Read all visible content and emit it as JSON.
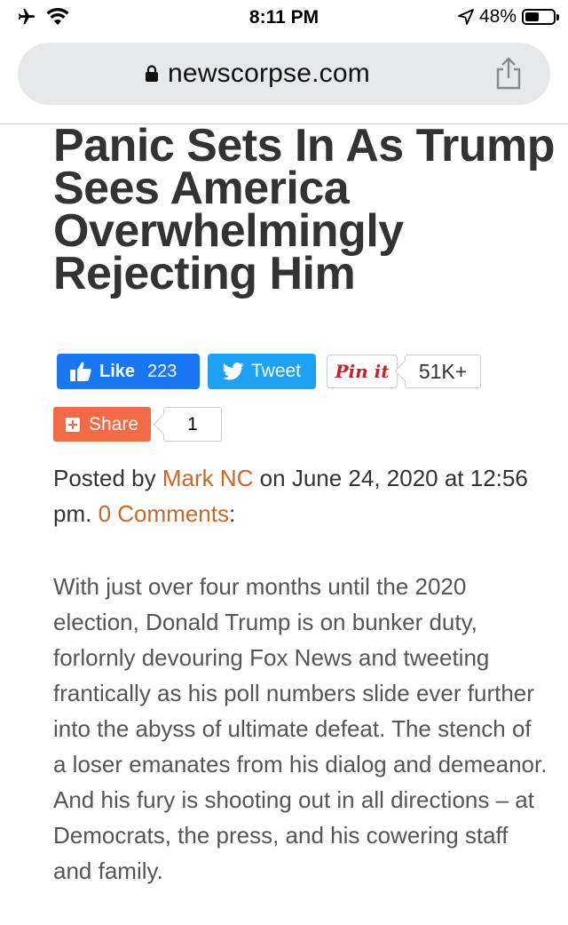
{
  "status_bar": {
    "time": "8:11 PM",
    "battery": "48%",
    "icons": [
      "airplane-icon",
      "wifi-icon",
      "location-arrow-icon",
      "battery-icon"
    ]
  },
  "browser": {
    "url": "newscorpse.com",
    "icons": [
      "lock-icon",
      "share-icon"
    ]
  },
  "article": {
    "title": "Panic Sets In As Trump Sees America Overwhelmingly Rejecting Him",
    "social": {
      "like_label": "Like",
      "like_count": "223",
      "tweet_label": "Tweet",
      "pin_label": "Pin it",
      "pin_count": "51K+",
      "share_label": "Share",
      "share_count": "1"
    },
    "byline": {
      "posted_by": "Posted by",
      "author": "Mark NC",
      "on_date": "on June 24, 2020 at 12:56 pm.",
      "comments": "0 Comments",
      "colon": ":"
    },
    "paragraph": "With just over four months until the 2020 election, Donald Trump is on bunker duty, forlornly devouring Fox News and tweeting frantically as his poll numbers slide ever further into the abyss of ultimate defeat. The stench of a loser emanates from his dialog and demeanor. And his fury is shooting out in all directions – at Democrats, the press, and his cowering staff and family."
  },
  "colors": {
    "link": "#c8682a",
    "facebook": "#1877f2",
    "twitter": "#1da1f2",
    "pinterest": "#cb2027",
    "share": "#f26b45"
  }
}
